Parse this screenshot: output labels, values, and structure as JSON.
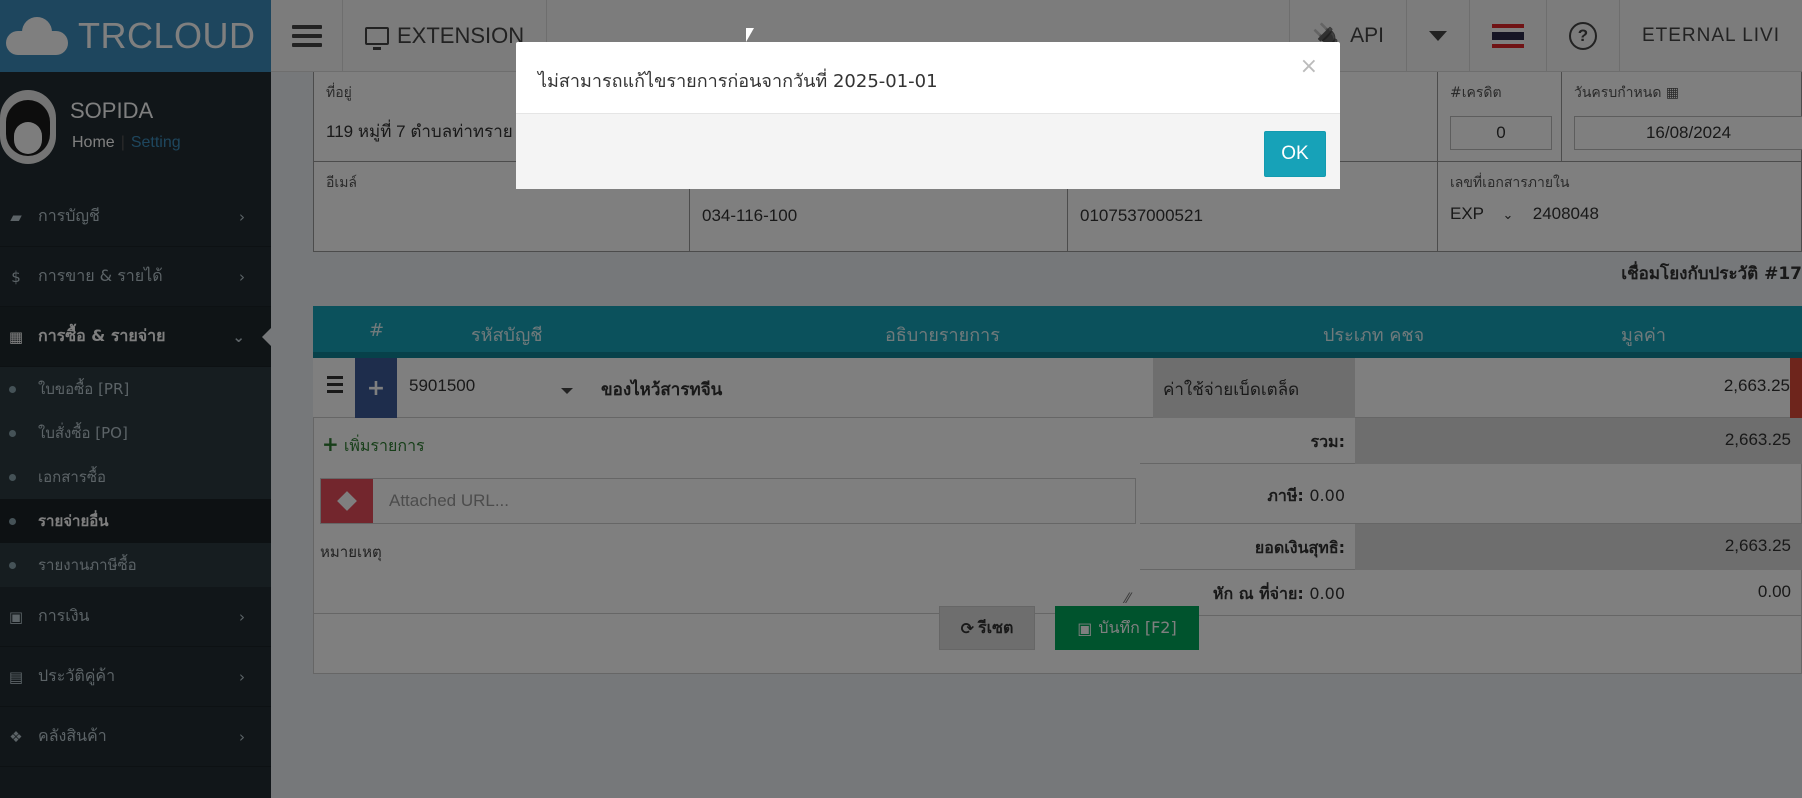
{
  "header": {
    "brand": "TRCLOUD",
    "extension_label": "EXTENSION",
    "api_label": "API",
    "company": "ETERNAL LIVI"
  },
  "sidebar": {
    "user_name": "SOPIDA",
    "home_link": "Home",
    "setting_link": "Setting",
    "menu": [
      {
        "label": "การบัญชี",
        "icon": "book-icon"
      },
      {
        "label": "การขาย & รายได้",
        "icon": "dollar-icon"
      },
      {
        "label": "การซื้อ & รายจ่าย",
        "icon": "cart-icon"
      },
      {
        "label": "การเงิน",
        "icon": "calendar-icon"
      },
      {
        "label": "ประวัติคู่ค้า",
        "icon": "contact-icon"
      },
      {
        "label": "คลังสินค้า",
        "icon": "cubes-icon"
      }
    ],
    "submenu": [
      {
        "label": "ใบขอซื้อ [PR]"
      },
      {
        "label": "ใบสั่งซื้อ [PO]"
      },
      {
        "label": "เอกสารซื้อ"
      },
      {
        "label": "รายจ่ายอื่น"
      },
      {
        "label": "รายงานภาษีซื้อ"
      }
    ]
  },
  "form": {
    "address_label": "ที่อยู่",
    "address_value": "119 หมู่ที่ 7 ตำบลท่าทราย",
    "credit_label": "#เครดิต",
    "credit_value": "0",
    "due_label": "วันครบกำหนด",
    "due_value": "16/08/2024",
    "email_label": "อีเมล์",
    "phone_value": "034-116-100",
    "taxid_value": "0107537000521",
    "internal_doc_label": "เลขที่เอกสารภายใน",
    "doc_prefix": "EXP",
    "doc_number": "2408048",
    "link_text": "เชื่อมโยงกับประวัติ #17"
  },
  "items_table": {
    "columns": [
      "#",
      "รหัสบัญชี",
      "อธิบายรายการ",
      "ประเภท คชจ",
      "มูลค่า"
    ],
    "rows": [
      {
        "account_code": "5901500",
        "description": "ของไหว้สารทจีน",
        "expense_type": "ค่าใช้จ่ายเบ็ดเตล็ด",
        "amount": "2,663.25"
      }
    ],
    "add_line": "เพิ่มรายการ"
  },
  "attachments": {
    "url_placeholder": "Attached URL...",
    "note_label": "หมายเหตุ"
  },
  "summary": {
    "total_label": "รวม:",
    "total_value": "2,663.25",
    "tax_label": "ภาษี:",
    "tax_value": "0.00",
    "net_label": "ยอดเงินสุทธิ:",
    "net_value": "2,663.25",
    "wht_label": "หัก ณ ที่จ่าย:",
    "wht_inline": "0.00",
    "wht_value": "0.00"
  },
  "actions": {
    "reset_label": "รีเซต",
    "save_label": "บันทึก [F2]"
  },
  "modal": {
    "message": "ไม่สามารถแก้ไขรายการก่อนจากวันที่ 2025-01-01",
    "close": "×",
    "ok_label": "OK"
  },
  "colors": {
    "brand_blue": "#3c8dbc",
    "sidebar": "#222d32",
    "table_header": "#17a2b8",
    "save_green": "#00a65a",
    "danger_red": "#dd4b39"
  }
}
